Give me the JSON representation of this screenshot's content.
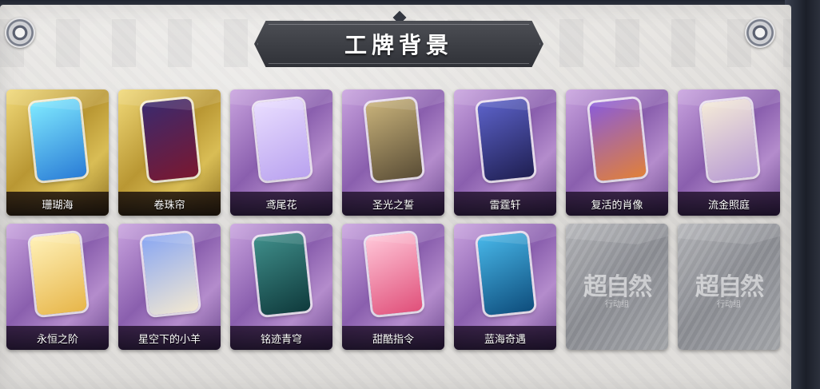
{
  "screen": {
    "title": "工牌背景"
  },
  "backgrounds": [
    {
      "label": "珊瑚海",
      "rarity": "gold",
      "art_colors": [
        "#7fe9ff",
        "#2a7cd6"
      ]
    },
    {
      "label": "卷珠帘",
      "rarity": "gold",
      "art_colors": [
        "#3b2a6e",
        "#7a1830"
      ]
    },
    {
      "label": "鸢尾花",
      "rarity": "purple",
      "art_colors": [
        "#e9ddff",
        "#b9a2ef"
      ]
    },
    {
      "label": "圣光之誓",
      "rarity": "purple",
      "art_colors": [
        "#c8b27a",
        "#5a4d36"
      ]
    },
    {
      "label": "雷霆轩",
      "rarity": "purple",
      "art_colors": [
        "#5c62c9",
        "#1f1f52"
      ]
    },
    {
      "label": "复活的肖像",
      "rarity": "purple",
      "art_colors": [
        "#8a5cd9",
        "#e0803a"
      ]
    },
    {
      "label": "流金照庭",
      "rarity": "purple",
      "art_colors": [
        "#f4ead8",
        "#b79ad3"
      ]
    },
    {
      "label": "永恒之阶",
      "rarity": "purple",
      "art_colors": [
        "#fff1b8",
        "#e7b64a"
      ]
    },
    {
      "label": "星空下的小羊",
      "rarity": "purple",
      "art_colors": [
        "#8aa7f2",
        "#f2e8d2"
      ]
    },
    {
      "label": "铭迹青穹",
      "rarity": "purple",
      "art_colors": [
        "#3f8e8a",
        "#0f3a3c"
      ]
    },
    {
      "label": "甜酷指令",
      "rarity": "purple",
      "art_colors": [
        "#ffc6d8",
        "#e0507a"
      ]
    },
    {
      "label": "蓝海奇遇",
      "rarity": "purple",
      "art_colors": [
        "#47b6e8",
        "#0e4d7c"
      ]
    },
    {
      "label": "",
      "rarity": "grey",
      "locked_mark": "超自然",
      "locked_sub": "行动组"
    },
    {
      "label": "",
      "rarity": "grey",
      "locked_mark": "超自然",
      "locked_sub": "行动组"
    }
  ]
}
